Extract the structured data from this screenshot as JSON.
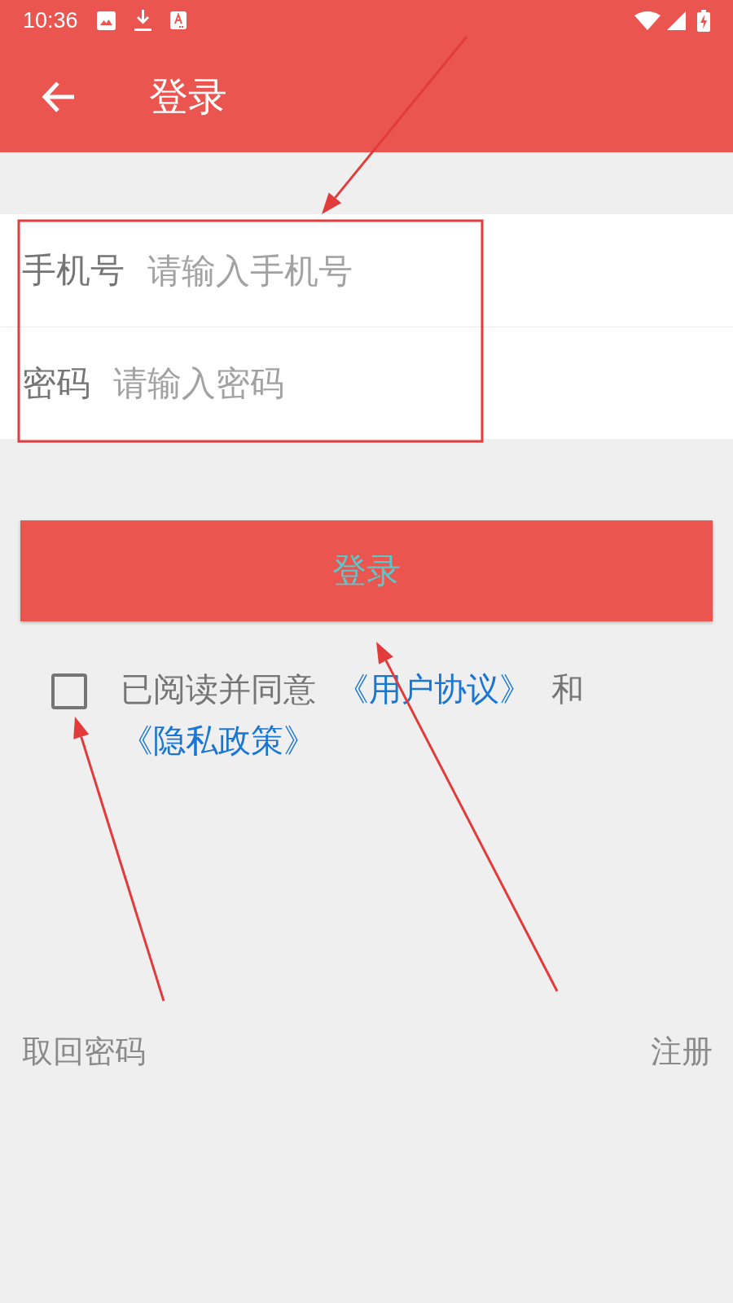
{
  "status_bar": {
    "time": "10:36"
  },
  "app_bar": {
    "title": "登录"
  },
  "form": {
    "fields": [
      {
        "label": "手机号",
        "placeholder": "请输入手机号"
      },
      {
        "label": "密码",
        "placeholder": "请输入密码"
      }
    ]
  },
  "login_button": {
    "label": "登录"
  },
  "agreement": {
    "checked": false,
    "parts": [
      {
        "kind": "text",
        "text": "已阅读并同意"
      },
      {
        "kind": "link",
        "text": "《用户协议》"
      },
      {
        "kind": "text",
        "text": "和"
      },
      {
        "kind": "link",
        "text": "《隐私政策》"
      }
    ]
  },
  "footer": {
    "links": [
      "取回密码",
      "注册"
    ]
  }
}
